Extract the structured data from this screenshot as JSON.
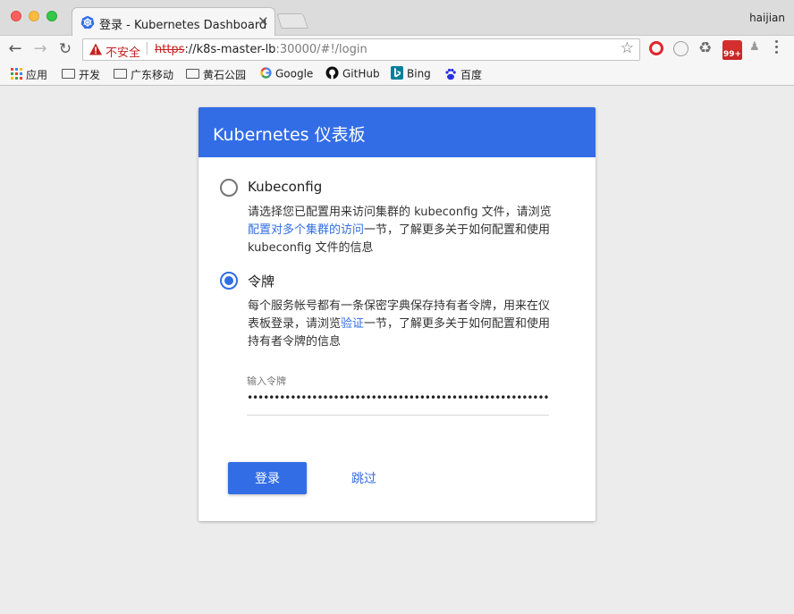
{
  "browser": {
    "tab_title": "登录 - Kubernetes Dashboard",
    "tab_close": "✕",
    "profile_name": "haijian",
    "security_label": "不安全",
    "url_scheme": "https",
    "url_host": "://k8s-master-lb",
    "url_rest": ":30000/#!/login",
    "badge_count": "99+",
    "bookmarks": [
      {
        "label": "应用",
        "icon": "apps-grid-icon"
      },
      {
        "label": "开发",
        "icon": "folder-icon"
      },
      {
        "label": "广东移动",
        "icon": "folder-icon"
      },
      {
        "label": "黄石公园",
        "icon": "folder-icon"
      },
      {
        "label": "Google",
        "icon": "google-icon"
      },
      {
        "label": "GitHub",
        "icon": "github-icon"
      },
      {
        "label": "Bing",
        "icon": "bing-icon"
      },
      {
        "label": "百度",
        "icon": "baidu-icon"
      }
    ]
  },
  "login": {
    "title": "Kubernetes 仪表板",
    "kubeconfig": {
      "label": "Kubeconfig",
      "selected": false,
      "desc_before": "请选择您已配置用来访问集群的 kubeconfig 文件，请浏览",
      "desc_link": "配置对多个集群的访问",
      "desc_after": "一节，了解更多关于如何配置和使用 kubeconfig 文件的信息"
    },
    "token": {
      "label": "令牌",
      "selected": true,
      "desc_before": "每个服务帐号都有一条保密字典保存持有者令牌，用来在仪表板登录，请浏览",
      "desc_link": "验证",
      "desc_after": "一节，了解更多关于如何配置和使用持有者令牌的信息",
      "input_label": "输入令牌",
      "input_value": "••••••••••••••••••••••••••••••••••••••••••••••••••••••••••"
    },
    "login_button": "登录",
    "skip_button": "跳过"
  },
  "colors": {
    "accent": "#326de6",
    "insecure": "#c5221f"
  }
}
